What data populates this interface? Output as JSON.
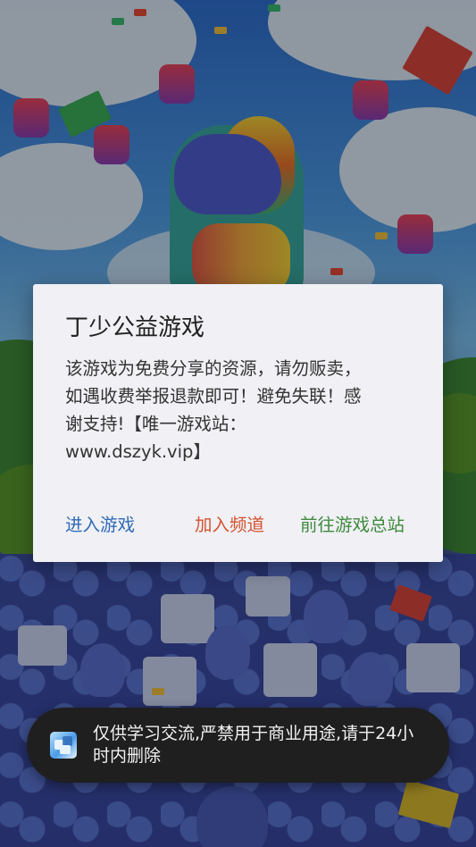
{
  "dialog": {
    "title": "丁少公益游戏",
    "message": "该游戏为免费分享的资源，请勿贩卖，如遇收费举报退款即可！避免失联！感谢支持!【唯一游戏站：www.dszyk.vip】",
    "buttons": {
      "enter_game": "进入游戏",
      "join_channel": "加入频道",
      "go_portal": "前往游戏总站"
    },
    "colors": {
      "enter_game": "#2f6ab6",
      "join_channel": "#d4522e",
      "go_portal": "#3f8a3c"
    }
  },
  "toast": {
    "icon": "game-app-icon",
    "text": "仅供学习交流,严禁用于商业用途,请于24小时内删除"
  }
}
